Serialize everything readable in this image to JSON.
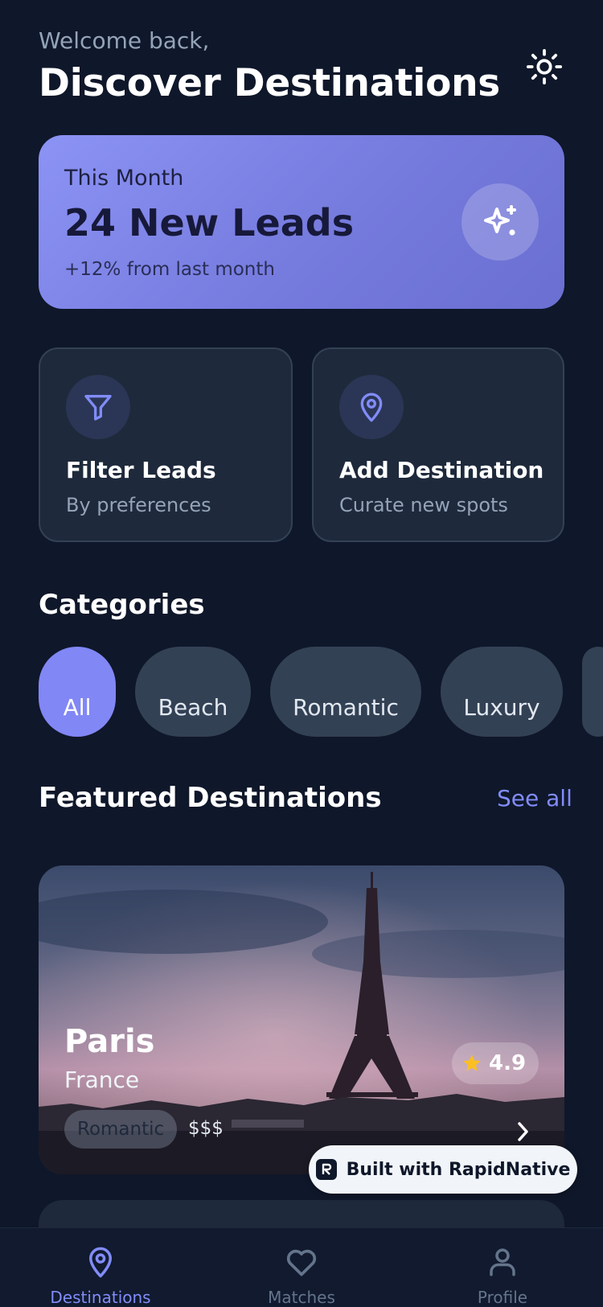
{
  "header": {
    "welcome": "Welcome back,",
    "title": "Discover Destinations",
    "theme_icon": "sun-icon"
  },
  "stats": {
    "period": "This Month",
    "value": "24 New Leads",
    "change": "+12% from last month",
    "icon": "sparkles-icon"
  },
  "actions": [
    {
      "title": "Filter Leads",
      "subtitle": "By preferences",
      "icon": "filter-icon"
    },
    {
      "title": "Add Destination",
      "subtitle": "Curate new spots",
      "icon": "map-pin-icon"
    }
  ],
  "categories": {
    "title": "Categories",
    "items": [
      "All",
      "Beach",
      "Romantic",
      "Luxury"
    ],
    "selected": "All"
  },
  "featured": {
    "title": "Featured Destinations",
    "see_all": "See all",
    "items": [
      {
        "name": "Paris",
        "country": "France",
        "tag": "Romantic",
        "price": "$$$",
        "rating": "4.9"
      }
    ]
  },
  "badge": {
    "text": "Built with RapidNative"
  },
  "nav": {
    "items": [
      {
        "label": "Destinations",
        "icon": "map-pin-icon",
        "active": true
      },
      {
        "label": "Matches",
        "icon": "heart-icon",
        "active": false
      },
      {
        "label": "Profile",
        "icon": "user-icon",
        "active": false
      }
    ]
  },
  "colors": {
    "background": "#0f172a",
    "card": "#1e293b",
    "accent": "#818cf8",
    "star": "#fbbf24"
  }
}
